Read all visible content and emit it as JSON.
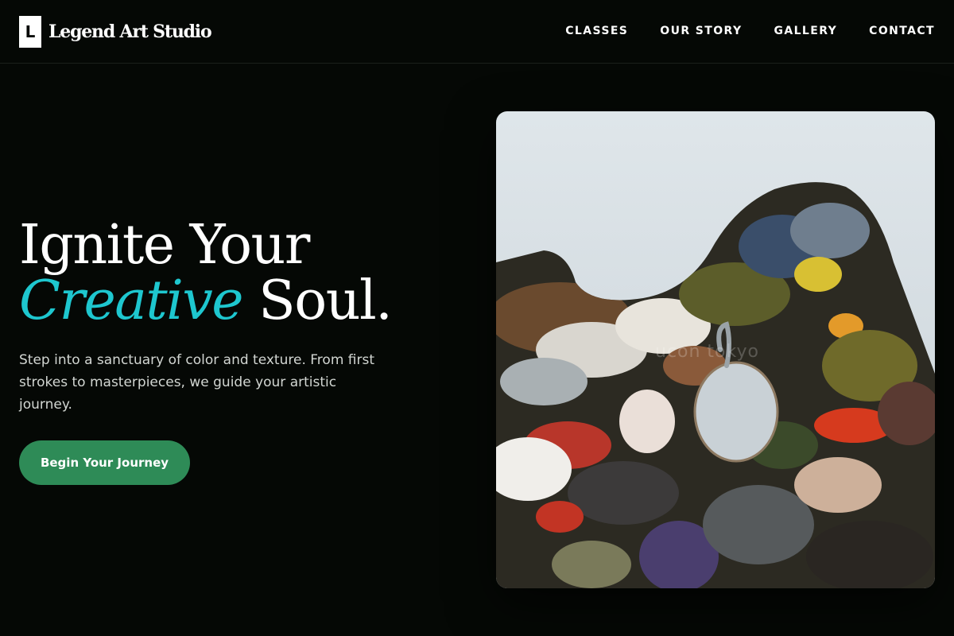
{
  "header": {
    "logo_mark": "L",
    "logo_text": "Legend Art Studio",
    "nav": [
      {
        "label": "CLASSES"
      },
      {
        "label": "OUR STORY"
      },
      {
        "label": "GALLERY"
      },
      {
        "label": "CONTACT"
      }
    ]
  },
  "hero": {
    "title_line1": "Ignite Your",
    "title_accent": "Creative",
    "title_end": " Soul.",
    "subtitle": "Step into a sanctuary of color and texture. From first strokes to masterpieces, we guide your artistic journey.",
    "cta_label": "Begin Your Journey",
    "image_alt": "Artist palette covered in thick oil paint",
    "watermark": "ucon tokyo"
  },
  "colors": {
    "background": "#050805",
    "accent": "#1ec7cf",
    "cta": "#2e8b57"
  },
  "icons": {
    "logo": "letter-L-logo-icon"
  }
}
